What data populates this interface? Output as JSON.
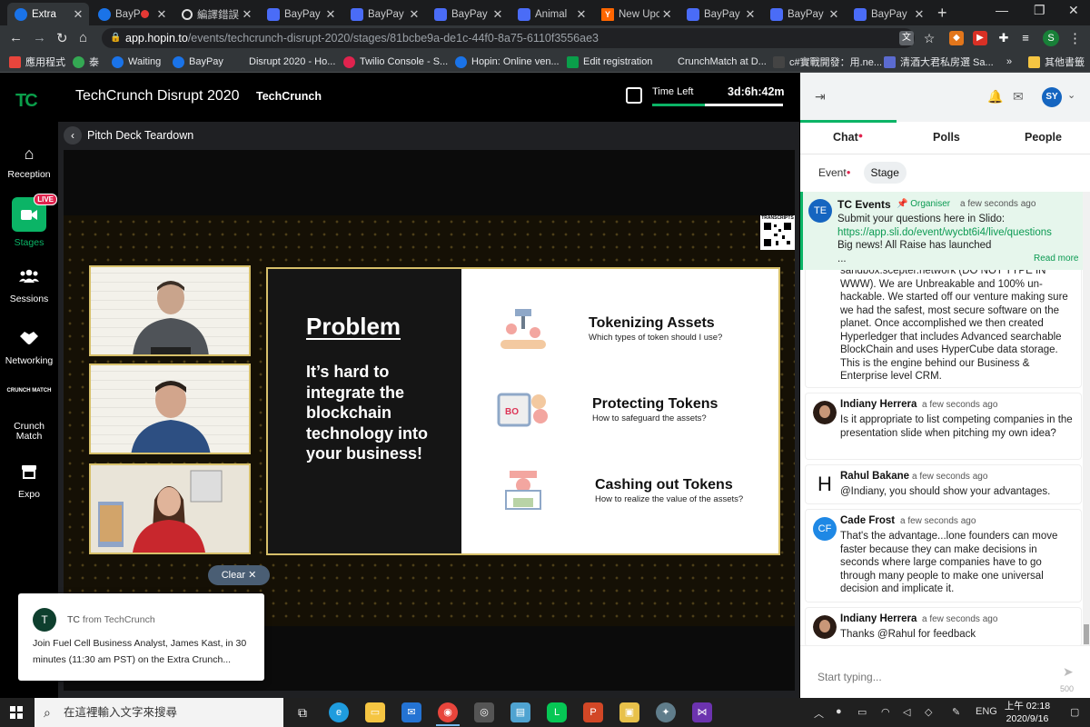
{
  "browser": {
    "tabs": [
      {
        "title": "Extra",
        "icon": "hopin-icon",
        "active": true
      },
      {
        "title": "BayP",
        "icon": "hopin-icon",
        "recording": true
      },
      {
        "title": "編譯錯誤",
        "icon": "globe-icon"
      },
      {
        "title": "BayPay",
        "icon": "anim-icon"
      },
      {
        "title": "BayPay",
        "icon": "anim-icon"
      },
      {
        "title": "BayPay",
        "icon": "anim-icon"
      },
      {
        "title": "Animal",
        "icon": "anim-icon"
      },
      {
        "title": "New Upc",
        "icon": "yc-icon"
      },
      {
        "title": "BayPay",
        "icon": "anim-icon"
      },
      {
        "title": "BayPay",
        "icon": "anim-icon"
      },
      {
        "title": "BayPay",
        "icon": "anim-icon"
      }
    ],
    "new_tab": "+",
    "url_host": "app.hopin.to",
    "url_path": "/events/techcrunch-disrupt-2020/stages/81bcbe9a-de1c-44f0-8a75-6110f3556ae3",
    "profile_initial": "S",
    "bookmarks": [
      {
        "label": "應用程式",
        "color": "#e8453c"
      },
      {
        "label": "泰",
        "color": "#34a853"
      },
      {
        "label": "Waiting",
        "color": "#1a73e8"
      },
      {
        "label": "BayPay",
        "color": "#1a73e8"
      },
      {
        "label": "Disrupt 2020 - Ho...",
        "color": "#323639"
      },
      {
        "label": "Twilio Console - S...",
        "color": "#e0234e"
      },
      {
        "label": "Hopin: Online ven...",
        "color": "#1a73e8"
      },
      {
        "label": "Edit registration",
        "color": "#0a9e4a"
      },
      {
        "label": "CrunchMatch at D...",
        "color": "#323639"
      },
      {
        "label": "c#實戰開發：用.ne...",
        "color": "#444"
      },
      {
        "label": "清酒大君私房選 Sa...",
        "color": "#5b6bd0"
      }
    ],
    "bookmarks_more": "»",
    "other_bookmarks": "其他書籤"
  },
  "app": {
    "logo": "TC",
    "event_title": "TechCrunch Disrupt 2020",
    "organizer": "TechCrunch",
    "time_left_label": "Time Left",
    "time_left_value": "3d:6h:42m",
    "time_left_progress": 0.4,
    "nav": [
      {
        "label": "Reception",
        "icon": "home-icon"
      },
      {
        "label": "Stages",
        "icon": "video-camera-icon",
        "badge": "LIVE",
        "active": true
      },
      {
        "label": "Sessions",
        "icon": "people-icon"
      },
      {
        "label": "Networking",
        "icon": "handshake-icon"
      },
      {
        "label": "Crunch Match",
        "icon": "crunchmatch-icon",
        "icon_caption": "CRUNCH MATCH"
      },
      {
        "label": "Expo",
        "icon": "booth-icon"
      }
    ],
    "stage_name": "Pitch Deck Teardown"
  },
  "broadcast": {
    "qr_label": "TRANSCRIPTS",
    "slide": {
      "heading": "Problem",
      "body": "It’s hard to integrate the blockchain technology into your business!",
      "items": [
        {
          "title": "Tokenizing Assets",
          "subtitle": "Which types of token should I use?"
        },
        {
          "title": "Protecting Tokens",
          "subtitle": "How to safeguard the assets?"
        },
        {
          "title": "Cashing out Tokens",
          "subtitle": "How to realize the value of the assets?"
        }
      ]
    },
    "clear_button": "Clear"
  },
  "toast": {
    "avatar": "T",
    "sender": "TC",
    "from": "from TechCrunch",
    "message": "Join Fuel Cell Business Analyst, James Kast, in 30 minutes (11:30 am PST) on the Extra Crunch..."
  },
  "sidebar": {
    "user_initials": "SY",
    "tabs": [
      "Chat",
      "Polls",
      "People"
    ],
    "subtabs": [
      "Event",
      "Stage"
    ],
    "pinned": {
      "avatar": "TE",
      "name": "TC Events",
      "role": "Organiser",
      "time": "a few seconds ago",
      "text_1": "Submit your questions here in Slido:",
      "link": "https://app.sli.do/event/wycbt6i4/live/questions",
      "text_2": "Big news! All Raise has launched",
      "ellipsis": "...",
      "read_more": "Read more"
    },
    "messages": [
      {
        "text": "sandbox.scepter.network (DO NOT TYPE IN WWW). We are Unbreakable and 100% un-hackable. We started off our venture making sure we had the safest, most secure software on the planet. Once accomplished we then created Hyperledger that includes Advanced searchable BlockChain and uses HyperCube data storage. This is the engine behind our Business & Enterprise level CRM."
      },
      {
        "name": "Indiany Herrera",
        "time": "a few seconds ago",
        "avatar": "",
        "text": "Is it appropriate to list competing companies in the presentation slide when pitching my own idea?"
      },
      {
        "name": "Rahul Bakane",
        "time": "a few seconds ago",
        "avatar": "H",
        "text": "@Indiany, you should show your advantages."
      },
      {
        "name": "Cade Frost",
        "time": "a few seconds ago",
        "avatar": "CF",
        "text": "That's the advantage...lone founders can move faster because they can make decisions in seconds where large companies have to go through many people to make one universal decision and implicate it."
      },
      {
        "name": "Indiany Herrera",
        "time": "a few seconds ago",
        "avatar": "",
        "text": "Thanks @Rahul for feedback"
      }
    ],
    "input_placeholder": "Start typing...",
    "char_count": "500"
  },
  "taskbar": {
    "search_placeholder": "在這裡輸入文字來搜尋",
    "lang": "ENG",
    "time": "上午 02:18",
    "date": "2020/9/16"
  }
}
